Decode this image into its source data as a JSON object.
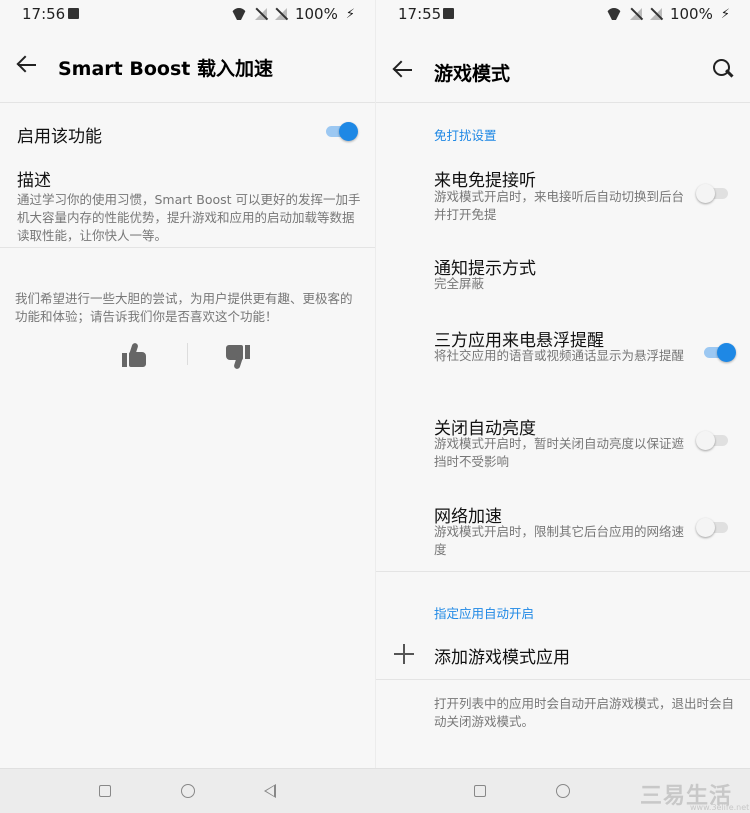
{
  "left": {
    "status": {
      "time": "17:56",
      "battery": "100%"
    },
    "title": "Smart Boost 载入加速",
    "enable_label": "启用该功能",
    "enable_on": true,
    "desc_title": "描述",
    "desc_text": "通过学习你的使用习惯，Smart Boost 可以更好的发挥一加手机大容量内存的性能优势，提升游戏和应用的启动加载等数据读取性能，让你快人一等。",
    "feedback_text": "我们希望进行一些大胆的尝试，为用户提供更有趣、更极客的功能和体验；请告诉我们你是否喜欢这个功能！"
  },
  "right": {
    "status": {
      "time": "17:55",
      "battery": "100%"
    },
    "title": "游戏模式",
    "section1": "免打扰设置",
    "items": [
      {
        "title": "来电免提接听",
        "sub": "游戏模式开启时，来电接听后自动切换到后台并打开免提",
        "on": false
      },
      {
        "title": "通知提示方式",
        "sub": "完全屏蔽"
      },
      {
        "title": "三方应用来电悬浮提醒",
        "sub": "将社交应用的语音或视频通话显示为悬浮提醒",
        "on": true
      },
      {
        "title": "关闭自动亮度",
        "sub": "游戏模式开启时，暂时关闭自动亮度以保证遮挡时不受影响",
        "on": false
      },
      {
        "title": "网络加速",
        "sub": "游戏模式开启时，限制其它后台应用的网络速度",
        "on": false
      }
    ],
    "section2": "指定应用自动开启",
    "add_label": "添加游戏模式应用",
    "footer_text": "打开列表中的应用时会自动开启游戏模式，退出时会自动关闭游戏模式。"
  },
  "watermark": {
    "main": "三易生活",
    "sub": "www.3elife.net"
  },
  "colors": {
    "accent": "#1e88e5",
    "background": "#f7f7f7"
  }
}
